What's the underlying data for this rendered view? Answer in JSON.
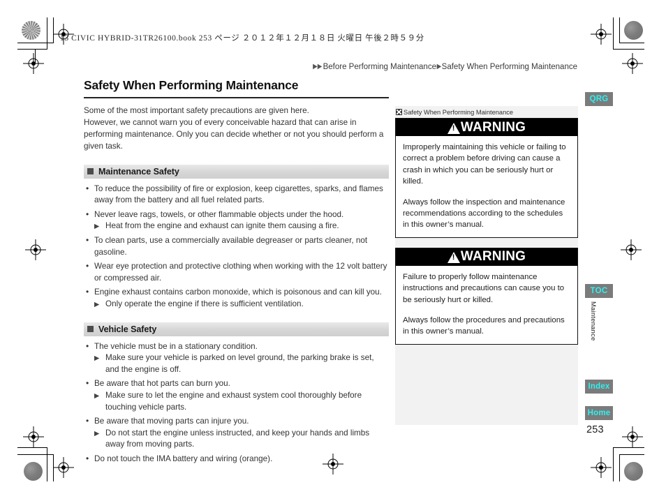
{
  "book_header": "13 CIVIC HYBRID-31TR26100.book   253 ページ   ２０１２年１２月１８日   火曜日   午後２時５９分",
  "breadcrumb": {
    "arrow_double": "▶▶",
    "arrow_single": "▶",
    "parent": "Before Performing Maintenance",
    "current": "Safety When Performing Maintenance"
  },
  "main": {
    "title": "Safety When Performing Maintenance",
    "intro": [
      "Some of the most important safety precautions are given here.",
      "However, we cannot warn you of every conceivable hazard that can arise in performing maintenance. Only you can decide whether or not you should perform a given task."
    ],
    "sections": [
      {
        "heading": "Maintenance Safety",
        "items": [
          {
            "text": "To reduce the possibility of fire or explosion, keep cigarettes, sparks, and flames away from the battery and all fuel related parts.",
            "sub": null
          },
          {
            "text": "Never leave rags, towels, or other flammable objects under the hood.",
            "sub": "Heat from the engine and exhaust can ignite them causing a fire."
          },
          {
            "text": "To clean parts, use a commercially available degreaser or parts cleaner, not gasoline.",
            "sub": null
          },
          {
            "text": "Wear eye protection and protective clothing when working with the 12 volt battery or compressed air.",
            "sub": null
          },
          {
            "text": "Engine exhaust contains carbon monoxide, which is poisonous and can kill you.",
            "sub": "Only operate the engine if there is sufficient ventilation."
          }
        ]
      },
      {
        "heading": "Vehicle Safety",
        "items": [
          {
            "text": "The vehicle must be in a stationary condition.",
            "sub": "Make sure your vehicle is parked on level ground, the parking brake is set, and the engine is off."
          },
          {
            "text": "Be aware that hot parts can burn you.",
            "sub": "Make sure to let the engine and exhaust system cool thoroughly before touching vehicle parts."
          },
          {
            "text": "Be aware that moving parts can injure you.",
            "sub": "Do not start the engine unless instructed, and keep your hands and limbs away from moving parts."
          },
          {
            "text": "Do not touch the IMA battery and wiring (orange).",
            "sub": null
          }
        ]
      }
    ]
  },
  "side_panel": {
    "reference_label": "Safety When Performing Maintenance",
    "warnings": [
      {
        "title": "WARNING",
        "paragraphs": [
          "Improperly maintaining this vehicle or failing to correct a problem before driving can cause a crash in which you can be seriously hurt or killed.",
          "Always follow the inspection and maintenance recommendations according to the schedules in this owner’s manual."
        ]
      },
      {
        "title": "WARNING",
        "paragraphs": [
          "Failure to properly follow maintenance instructions and precautions can cause you to be seriously hurt or killed.",
          "Always follow the procedures and precautions in this owner’s manual."
        ]
      }
    ]
  },
  "nav_tabs": {
    "qrg": "QRG",
    "toc": "TOC",
    "index": "Index",
    "home": "Home"
  },
  "chapter_label": "Maintenance",
  "page_number": "253",
  "colors": {
    "tab_background": "#7b7b7b",
    "tab_text": "#2ff0f0",
    "warning_bar": "#000000",
    "section_header": "#d6d6d6",
    "side_panel": "#f2f2f2"
  }
}
